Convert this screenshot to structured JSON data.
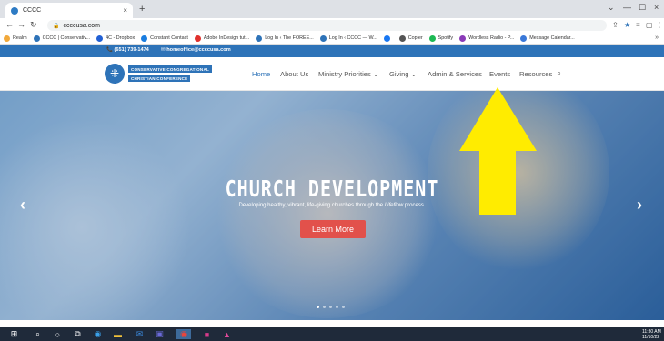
{
  "browser": {
    "tab_title": "CCCC",
    "tab_close": "×",
    "new_tab": "+",
    "win_min": "—",
    "win_max": "☐",
    "win_close": "×",
    "url": "ccccusa.com"
  },
  "bookmarks": [
    {
      "label": "Realm",
      "color": "#f2a93b"
    },
    {
      "label": "CCCC | Conservativ...",
      "color": "#2e73b8"
    },
    {
      "label": "4C - Dropbox",
      "color": "#2160d4"
    },
    {
      "label": "Constant Contact",
      "color": "#1a7de0"
    },
    {
      "label": "Adobe InDesign tut...",
      "color": "#e0312d"
    },
    {
      "label": "Log In ‹ The FOREE...",
      "color": "#2e73b8"
    },
    {
      "label": "Log In ‹ CCCC — W...",
      "color": "#2e73b8"
    },
    {
      "label": "",
      "color": "#1877f2"
    },
    {
      "label": "Copier",
      "color": "#555555"
    },
    {
      "label": "Spotify",
      "color": "#1db954"
    },
    {
      "label": "Wordless Radio - P...",
      "color": "#8a3bb8"
    },
    {
      "label": "Message Calendar...",
      "color": "#3a78d8"
    }
  ],
  "bookmarks_more": "»",
  "info": {
    "phone": "(651) 739-1474",
    "email": "homeoffice@ccccusa.com"
  },
  "logo": {
    "line1": "CONSERVATIVE CONGREGATIONAL",
    "line2": "CHRISTIAN CONFERENCE"
  },
  "menu": [
    {
      "label": "Home",
      "active": true
    },
    {
      "label": "About Us",
      "active": false
    },
    {
      "label": "Ministry Priorities ⌄",
      "active": false
    },
    {
      "label": "Giving ⌄",
      "active": false
    },
    {
      "label": "Admin & Services",
      "active": false
    },
    {
      "label": "Events",
      "active": false
    },
    {
      "label": "Resources",
      "active": false
    }
  ],
  "hero": {
    "title": "CHURCH DEVELOPMENT",
    "subtitle_pre": "Developing healthy, vibrant, life-giving churches through the ",
    "subtitle_em": "Lifeflow",
    "subtitle_post": " process.",
    "button": "Learn More",
    "prev": "‹",
    "next": "›",
    "slide_count": 5,
    "active_slide": 1
  },
  "taskbar": {
    "time": "11:30 AM",
    "date": "11/10/22"
  },
  "colors": {
    "brand": "#2e73b8",
    "cta": "#e2514b",
    "annotation_arrow": "#ffec00"
  }
}
